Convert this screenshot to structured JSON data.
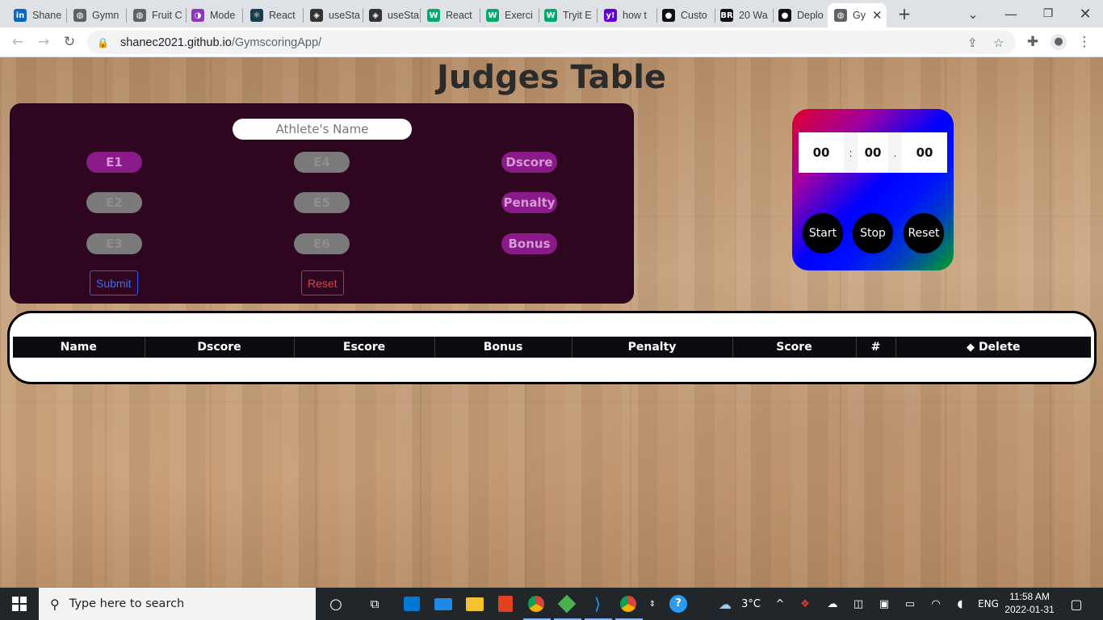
{
  "browser": {
    "tabs": [
      {
        "title": "Shane",
        "icon": "linkedin-icon",
        "color": "#0a66c2",
        "glyph": "in"
      },
      {
        "title": "Gymn",
        "icon": "globe-icon",
        "color": "#5f6368",
        "glyph": "◍"
      },
      {
        "title": "Fruit C",
        "icon": "globe-icon",
        "color": "#5f6368",
        "glyph": "◍"
      },
      {
        "title": "Mode",
        "icon": "purple-circle-icon",
        "color": "#8a3ab9",
        "glyph": "◑"
      },
      {
        "title": "React",
        "icon": "react-icon",
        "color": "#1b3a4b",
        "glyph": "⚛"
      },
      {
        "title": "useSta",
        "icon": "codesandbox-icon",
        "color": "#333333",
        "glyph": "◈"
      },
      {
        "title": "useSta",
        "icon": "codesandbox-icon",
        "color": "#333333",
        "glyph": "◈"
      },
      {
        "title": "React",
        "icon": "w3schools-icon",
        "color": "#04aa6d",
        "glyph": "W"
      },
      {
        "title": "Exerci",
        "icon": "w3schools-icon",
        "color": "#04aa6d",
        "glyph": "W"
      },
      {
        "title": "Tryit E",
        "icon": "w3schools-icon",
        "color": "#04aa6d",
        "glyph": "W"
      },
      {
        "title": "how t",
        "icon": "yahoo-icon",
        "color": "#6001d2",
        "glyph": "y!"
      },
      {
        "title": "Custo",
        "icon": "github-icon",
        "color": "#111111",
        "glyph": "●"
      },
      {
        "title": "20 Wa",
        "icon": "bleacher-report-icon",
        "color": "#111111",
        "glyph": "BR"
      },
      {
        "title": "Deplo",
        "icon": "github-icon",
        "color": "#111111",
        "glyph": "●"
      },
      {
        "title": "Gy",
        "icon": "globe-icon",
        "color": "#5f6368",
        "glyph": "◍",
        "active": true
      }
    ],
    "new_tab_glyph": "+",
    "url_host": "shanec2021.github.io",
    "url_path": "/GymscoringApp/"
  },
  "page": {
    "title": "Judges Table",
    "athlete_placeholder": "Athlete's Name",
    "inputs": {
      "e1": "E1",
      "e2": "E2",
      "e3": "E3",
      "e4": "E4",
      "e5": "E5",
      "e6": "E6",
      "dscore": "Dscore",
      "penalty": "Penalty",
      "bonus": "Bonus"
    },
    "submit_label": "Submit",
    "reset_label": "Reset"
  },
  "stopwatch": {
    "minutes": "00",
    "seconds": "00",
    "centiseconds": "00",
    "sep1": ":",
    "sep2": ".",
    "start_label": "Start",
    "stop_label": "Stop",
    "reset_label": "Reset"
  },
  "table": {
    "columns": [
      "Name",
      "Dscore",
      "Escore",
      "Bonus",
      "Penalty",
      "Score",
      "#",
      "Delete"
    ]
  },
  "taskbar": {
    "search_placeholder": "Type here to search",
    "weather": "3°C",
    "language": "ENG",
    "time": "11:58 AM",
    "date": "2022-01-31"
  }
}
